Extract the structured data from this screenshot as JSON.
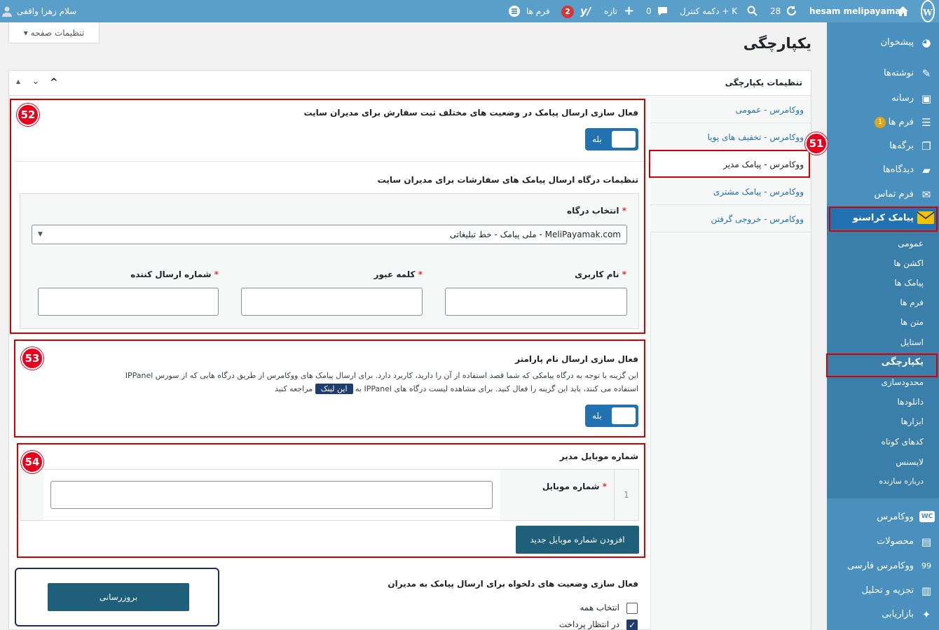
{
  "admin_bar": {
    "greeting": "سلام زهرا واقفی",
    "site_name": "hesam melipayamak",
    "updates_count": "28",
    "search_label": "دکمه کنترل + K",
    "comments_count": "0",
    "new_label": "تازه",
    "notif_count": "2",
    "forms_label": "فرم ها"
  },
  "sidebar": {
    "items": [
      {
        "label": "پیشخوان",
        "icon": "dashboard-icon"
      },
      {
        "label": "نوشته‌ها",
        "icon": "pin-icon"
      },
      {
        "label": "رسانه",
        "icon": "media-icon"
      },
      {
        "label": "فرم ها",
        "icon": "forms-icon",
        "badge": "1"
      },
      {
        "label": "برگه‌ها",
        "icon": "pages-icon"
      },
      {
        "label": "دیدگاه‌ها",
        "icon": "comments-icon"
      },
      {
        "label": "فرم تماس",
        "icon": "mail-icon"
      },
      {
        "label": "پیامک کراسنو",
        "icon": "envelope-icon"
      }
    ],
    "submenu": [
      "عمومی",
      "اکشن ها",
      "پیامک ها",
      "فرم ها",
      "متن ها",
      "استایل",
      "یکپارچگی",
      "محدودسازی",
      "دانلودها",
      "ابزارها",
      "کدهای کوتاه",
      "لایسنس",
      "درباره سازنده"
    ],
    "bottom_items": [
      {
        "label": "ووکامرس",
        "icon": "woo-icon"
      },
      {
        "label": "محصولات",
        "icon": "products-icon"
      },
      {
        "label": "ووکامرس فارسی",
        "icon": "woo-fa-icon"
      },
      {
        "label": "تجزیه و تحلیل",
        "icon": "analytics-icon"
      },
      {
        "label": "بازاریابی",
        "icon": "marketing-icon"
      }
    ]
  },
  "page": {
    "title": "یکپارچگی",
    "screen_options": "تنظیمات صفحه",
    "panel_title": "تنظیمات یکپارچگی"
  },
  "tabs": [
    "ووکامرس - عمومی",
    "ووکامرس - تخفیف های پویا",
    "ووکامرس - پیامک مدیر",
    "ووکامرس - پیامک مشتری",
    "ووکامرس - خروجی گرفتن"
  ],
  "markers": {
    "m51": "51",
    "m52": "52",
    "m53": "53",
    "m54": "54"
  },
  "section52": {
    "title": "فعال سازی ارسال پیامک در وضعیت های مختلف ثبت سفارش برای مدیران سایت",
    "toggle_label": "بله",
    "gateway_title": "تنظیمات درگاه ارسال پیامک های سفارشات برای مدیران سایت",
    "gateway_select_label": "انتخاب درگاه",
    "gateway_value": "MeliPayamak.com - ملی پیامک - خط تبلیغاتی",
    "username_label": "نام کاربری",
    "password_label": "کلمه عبور",
    "sender_label": "شماره ارسال کننده",
    "required_mark": "*"
  },
  "section53": {
    "title": "فعال سازی ارسال نام پارامتر",
    "desc_line1": "این گزینه با توجه به درگاه پیامکی که شما قصد استفاده از آن را دارید، کاربرد دارد. برای ارسال پیامک های ووکامرس از طریق درگاه هایی که از سورس IPPanel",
    "desc_line2_a": "استفاده می کنند، باید این گزینه را فعال کنید. برای مشاهده لیست درگاه های IPPanel به",
    "link_label": "این لینک",
    "desc_line2_b": "مراجعه کنید",
    "toggle_label": "بله"
  },
  "section54": {
    "title": "شماره موبایل مدیر",
    "row_number": "1",
    "mobile_label": "شماره موبایل",
    "add_button": "افزودن شماره موبایل جدید"
  },
  "section55": {
    "title": "فعال سازی وضعیت های دلخواه برای ارسال پیامک به مدیران",
    "select_all": "انتخاب همه",
    "pending": "در انتظار پرداخت",
    "update_button": "بروزرسانی"
  }
}
